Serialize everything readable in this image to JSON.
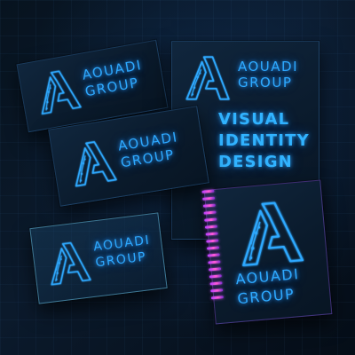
{
  "brand": {
    "name_line1": "AOUADI",
    "name_line2": "GROUP",
    "logo_icon": "letter-a-icon",
    "glow_color": "#2ea9ff"
  },
  "cards": {
    "card_1": {
      "line1": "AOUADI",
      "line2": "GROUP"
    },
    "card_2": {
      "line1": "AOUADI",
      "line2": "GROUP"
    },
    "card_3": {
      "line1": "AOUADI",
      "line2": "GROUP"
    },
    "poster": {
      "line1": "AOUADI",
      "line2": "GROUP"
    },
    "notebook": {
      "line1": "AOUADI",
      "line2": "GROUP"
    }
  },
  "headline": {
    "line1": "VISUAL",
    "line2": "IDENTITY",
    "line3": "DESIGN"
  },
  "colors": {
    "background": "#06101c",
    "card": "#0d2136",
    "accent_blue": "#2ea9ff",
    "spiral_pink": "#ff5bd6"
  }
}
